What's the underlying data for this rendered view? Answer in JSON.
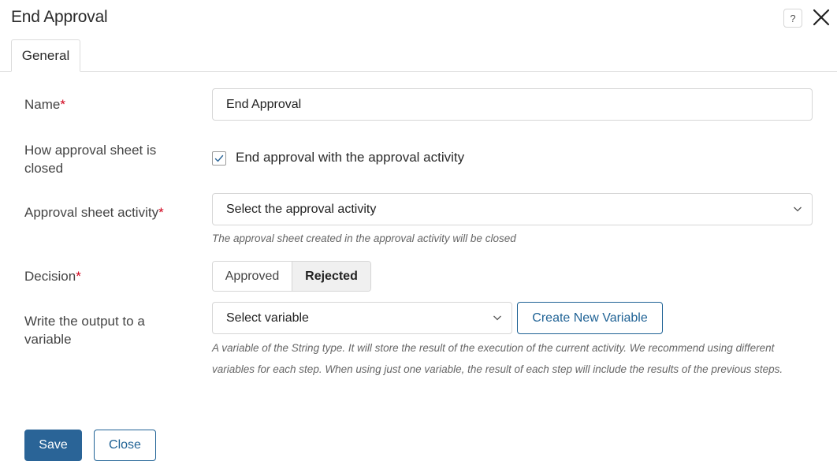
{
  "dialog": {
    "title": "End Approval",
    "help_label": "?",
    "tabs": [
      {
        "label": "General",
        "active": true
      }
    ]
  },
  "form": {
    "name": {
      "label": "Name",
      "required_mark": "*",
      "value": "End Approval"
    },
    "closing": {
      "label": "How approval sheet is closed",
      "checkbox_label": "End approval with the approval activity",
      "checked": true
    },
    "activity": {
      "label": "Approval sheet activity",
      "required_mark": "*",
      "value": "Select the approval activity",
      "hint": "The approval sheet created in the approval activity will be closed"
    },
    "decision": {
      "label": "Decision",
      "required_mark": "*",
      "options": [
        "Approved",
        "Rejected"
      ],
      "selected": "Rejected"
    },
    "output": {
      "label": "Write the output to a variable",
      "value": "Select variable",
      "create_button": "Create New Variable",
      "hint_line1": "A variable of the String type. It will store the result of the execution of the current activity. We recommend using different",
      "hint_line2": "variables for each step. When using just one variable, the result of each step will include the results of the previous steps."
    }
  },
  "footer": {
    "save_label": "Save",
    "close_label": "Close"
  },
  "colors": {
    "primary": "#2a6497",
    "required": "#d0021b",
    "border": "#d6d6d6"
  }
}
